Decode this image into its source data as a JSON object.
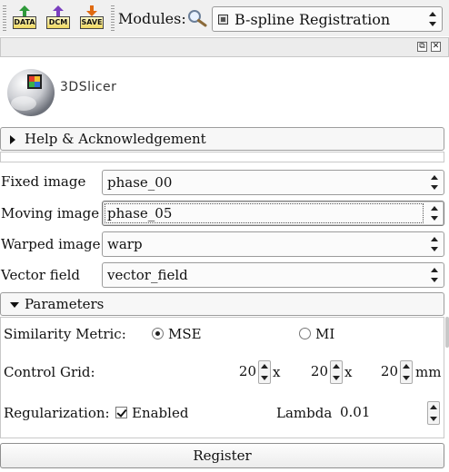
{
  "toolbar": {
    "data_label": "DATA",
    "dcm_label": "DCM",
    "save_label": "SAVE",
    "modules_label": "Modules:",
    "module_selected": "B-spline Registration"
  },
  "logo": {
    "text": "3DSlicer"
  },
  "help": {
    "label": "Help & Acknowledgement"
  },
  "io": {
    "fixed": {
      "label": "Fixed image",
      "value": "phase_00"
    },
    "moving": {
      "label": "Moving image",
      "value": "phase_05"
    },
    "warped": {
      "label": "Warped image",
      "value": "warp"
    },
    "vector": {
      "label": "Vector field",
      "value": "vector_field"
    }
  },
  "parameters": {
    "label": "Parameters",
    "similarity": {
      "label": "Similarity Metric:",
      "options": [
        "MSE",
        "MI"
      ],
      "selected": "MSE"
    },
    "grid": {
      "label": "Control Grid:",
      "x": "20",
      "y": "20",
      "z": "20",
      "sep": "x",
      "unit": "mm"
    },
    "regularization": {
      "label": "Regularization:",
      "enabled_label": "Enabled",
      "enabled": true,
      "lambda_label": "Lambda",
      "lambda_value": "0.01"
    }
  },
  "register_label": "Register",
  "colors": {
    "data_arrow": "#2f9a3a",
    "dcm_arrow": "#7a3fbf",
    "save_arrow": "#e06a10"
  }
}
